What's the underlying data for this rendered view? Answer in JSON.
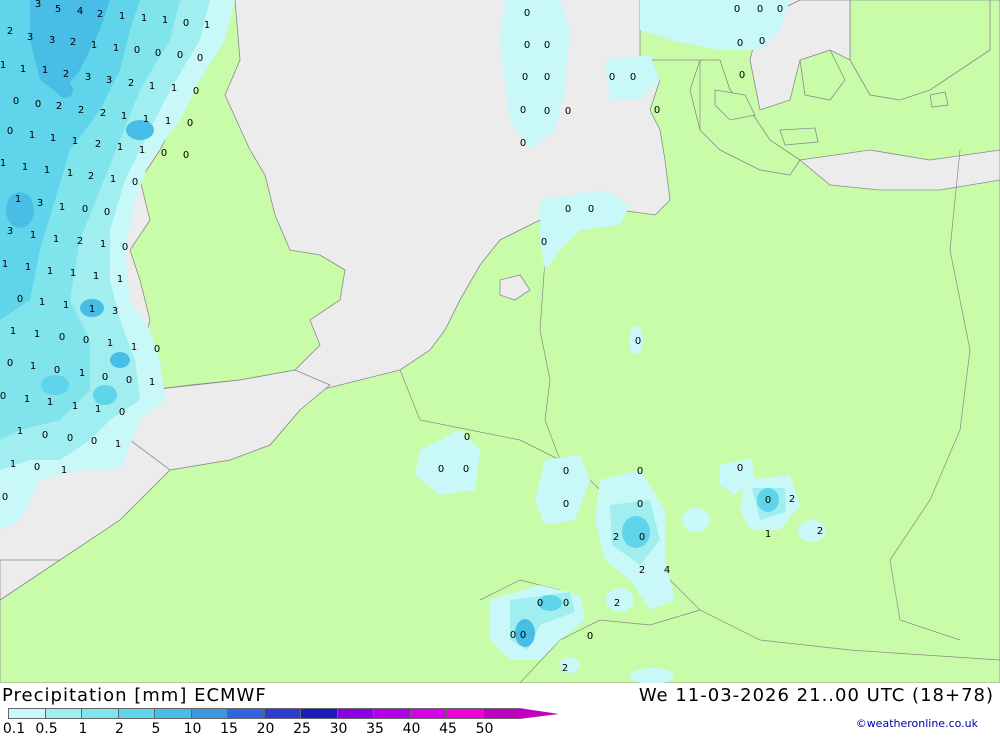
{
  "header": {
    "title": "Precipitation [mm] ECMWF",
    "datetime": "We 11-03-2026 21..00 UTC (18+78)"
  },
  "legend": {
    "ticks": [
      "0.1",
      "0.5",
      "1",
      "2",
      "5",
      "10",
      "15",
      "20",
      "25",
      "30",
      "35",
      "40",
      "45",
      "50"
    ],
    "colors": [
      "#c8f8f8",
      "#a0eef0",
      "#80e4ec",
      "#60d4ea",
      "#48bee6",
      "#3c96e0",
      "#3064e0",
      "#2a3cd2",
      "#1c1cbe",
      "#8c00e8",
      "#b400e8",
      "#d800e8",
      "#f000d8",
      "#c000c0"
    ]
  },
  "credit": "©weatheronline.co.uk",
  "colors": {
    "sea": "#ececec",
    "land": "#c8fca8",
    "precip_light": "#c8f8f8",
    "precip_mid": "#a0eef0",
    "precip_heavy": "#60d4ea",
    "precip_core": "#48bee6"
  },
  "map_values": [
    "3",
    "5",
    "4",
    "2",
    "1",
    "1",
    "1",
    "0",
    "1",
    "2",
    "3",
    "3",
    "2",
    "1",
    "1",
    "0",
    "0",
    "0",
    "0",
    "1",
    "1",
    "1",
    "2",
    "3",
    "3",
    "2",
    "1",
    "1",
    "0",
    "0",
    "0",
    "2",
    "2",
    "2",
    "1",
    "1",
    "1",
    "0",
    "0",
    "1",
    "1",
    "1",
    "2",
    "1",
    "1",
    "0",
    "0",
    "1",
    "1",
    "1",
    "1",
    "2",
    "1",
    "0",
    "1",
    "3",
    "1",
    "0",
    "0",
    "3",
    "1",
    "1",
    "2",
    "1",
    "0",
    "1",
    "1",
    "1",
    "1",
    "1",
    "1",
    "0",
    "1",
    "1",
    "1",
    "3",
    "1",
    "1",
    "0",
    "0",
    "1",
    "1",
    "0",
    "0",
    "1",
    "0",
    "1",
    "0",
    "0",
    "1",
    "0",
    "1",
    "1",
    "1",
    "1",
    "0",
    "1",
    "0",
    "0",
    "0",
    "1",
    "1",
    "0",
    "1",
    "0",
    "0",
    "0",
    "0",
    "0",
    "0",
    "0",
    "0",
    "0",
    "0",
    "0",
    "0",
    "0",
    "0",
    "0",
    "0",
    "0",
    "0",
    "0",
    "0",
    "0",
    "0",
    "0",
    "0",
    "0",
    "0",
    "0",
    "0",
    "0",
    "0",
    "0",
    "2",
    "0",
    "0",
    "2",
    "1",
    "2",
    "2",
    "4",
    "0",
    "0",
    "0",
    "0",
    "0",
    "2",
    "2",
    "0",
    "1",
    "0",
    "0"
  ]
}
